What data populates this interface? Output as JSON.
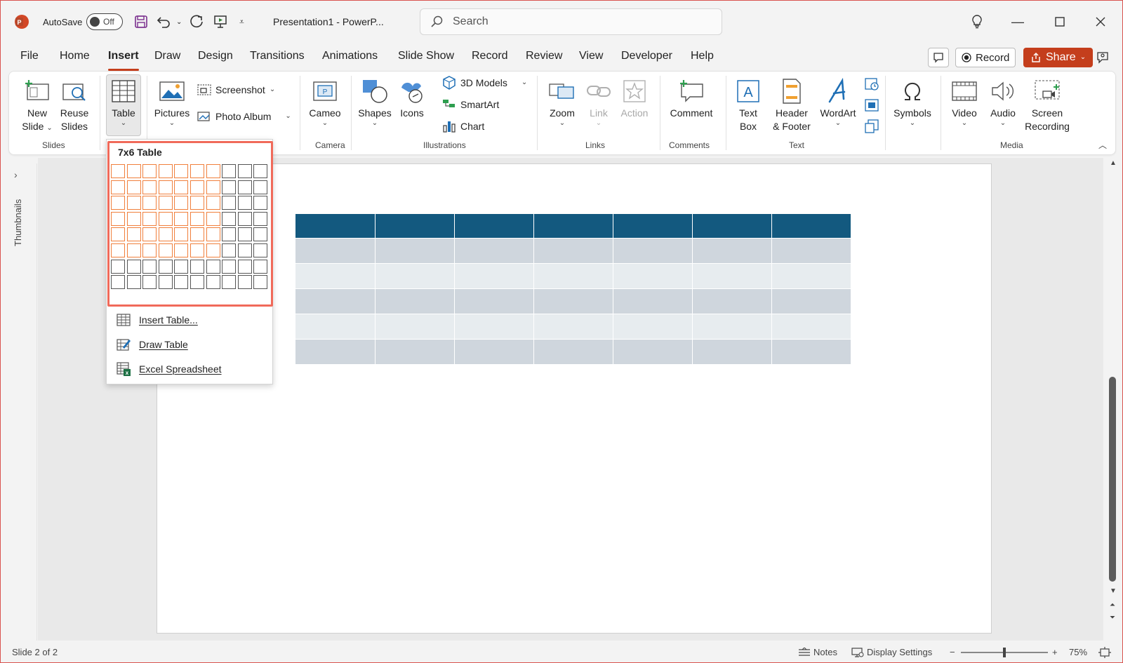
{
  "titlebar": {
    "autosave_label": "AutoSave",
    "autosave_state": "Off",
    "doc_title": "Presentation1  -  PowerP...",
    "search_placeholder": "Search"
  },
  "menu": {
    "tabs": [
      "File",
      "Home",
      "Insert",
      "Draw",
      "Design",
      "Transitions",
      "Animations",
      "Slide Show",
      "Record",
      "Review",
      "View",
      "Developer",
      "Help"
    ],
    "active_tab": "Insert",
    "record_label": "Record",
    "share_label": "Share"
  },
  "ribbon": {
    "slides": {
      "group": "Slides",
      "new_slide": [
        "New",
        "Slide"
      ],
      "reuse_slides": [
        "Reuse",
        "Slides"
      ]
    },
    "tables": {
      "table": "Table"
    },
    "images": {
      "pictures": "Pictures",
      "screenshot": "Screenshot",
      "photo_album": "Photo Album"
    },
    "camera": {
      "group": "Camera",
      "cameo": "Cameo"
    },
    "illustrations": {
      "group": "Illustrations",
      "shapes": "Shapes",
      "icons": "Icons",
      "models_3d": "3D Models",
      "smartart": "SmartArt",
      "chart": "Chart"
    },
    "links": {
      "group": "Links",
      "zoom": "Zoom",
      "link": "Link",
      "action": "Action"
    },
    "comments": {
      "group": "Comments",
      "comment": "Comment"
    },
    "text": {
      "group": "Text",
      "text_box": [
        "Text",
        "Box"
      ],
      "header_footer": [
        "Header",
        "& Footer"
      ],
      "wordart": "WordArt"
    },
    "symbols": {
      "symbols": "Symbols"
    },
    "media": {
      "group": "Media",
      "video": "Video",
      "audio": "Audio",
      "screen_recording": [
        "Screen",
        "Recording"
      ]
    }
  },
  "table_dropdown": {
    "title": "7x6 Table",
    "grid_columns": 10,
    "grid_rows": 8,
    "selected_columns": 7,
    "selected_rows": 6,
    "items": [
      "Insert Table...",
      "Draw Table",
      "Excel Spreadsheet"
    ]
  },
  "sidebar": {
    "label": "Thumbnails"
  },
  "statusbar": {
    "slide_info": "Slide 2 of 2",
    "notes": "Notes",
    "display_settings": "Display Settings",
    "zoom": "75%",
    "zoom_level": 0.5
  },
  "colors": {
    "accent": "#c43e1c",
    "table_header": "#13597f",
    "table_row_dark": "#cfd6dd",
    "table_row_light": "#e7ecef",
    "grid_highlight": "#f07f3c",
    "callout_frame": "#f06a5a"
  }
}
